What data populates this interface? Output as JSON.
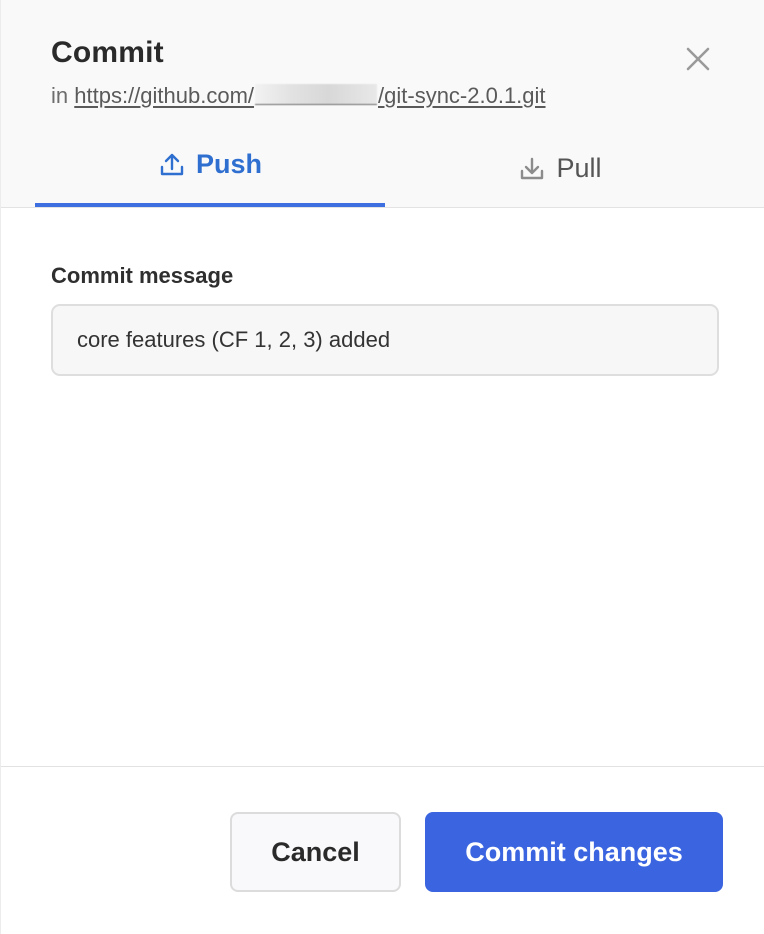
{
  "dialog": {
    "title": "Commit",
    "subtitle_prefix": "in",
    "repo_url_start": "https://github.com/",
    "repo_url_end": "/git-sync-2.0.1.git",
    "close_icon": "close-icon"
  },
  "tabs": [
    {
      "label": "Push",
      "icon": "upload-icon",
      "active": true
    },
    {
      "label": "Pull",
      "icon": "download-icon",
      "active": false
    }
  ],
  "form": {
    "message_label": "Commit message",
    "message_value": "core features (CF 1, 2, 3) added"
  },
  "footer": {
    "cancel_label": "Cancel",
    "commit_label": "Commit changes"
  },
  "colors": {
    "accent": "#3b65e0",
    "active_tab_text": "#2f6fd0",
    "header_bg": "#f9f9fa"
  }
}
